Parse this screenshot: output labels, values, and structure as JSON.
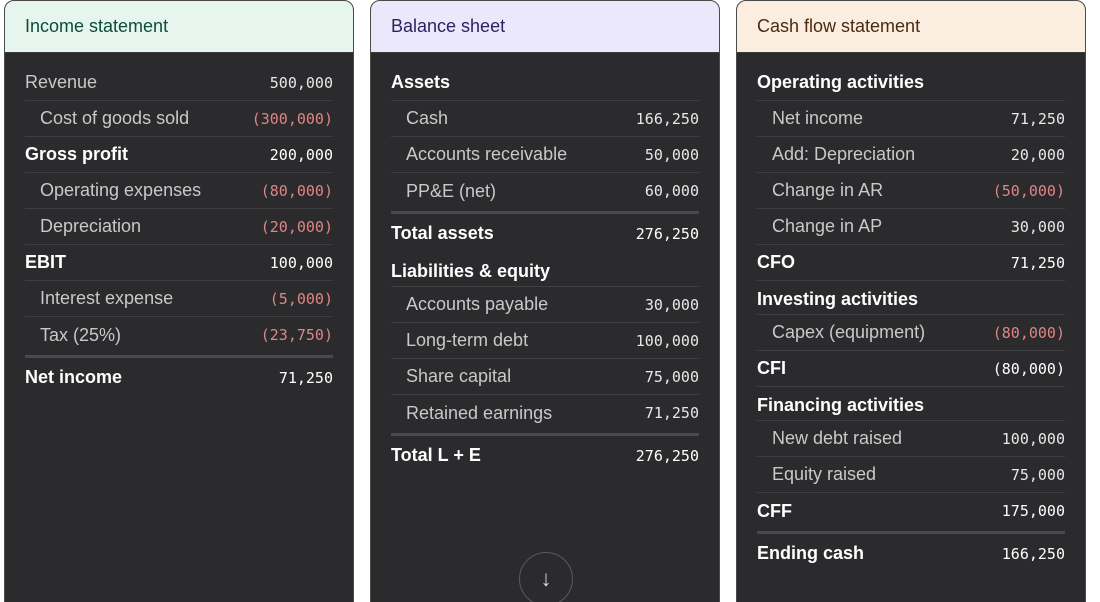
{
  "income": {
    "title": "Income statement",
    "rows": [
      {
        "label": "Revenue",
        "value": "500,000"
      },
      {
        "label": "Cost of goods sold",
        "value": "(300,000)"
      },
      {
        "label": "Gross profit",
        "value": "200,000"
      },
      {
        "label": "Operating expenses",
        "value": "(80,000)"
      },
      {
        "label": "Depreciation",
        "value": "(20,000)"
      },
      {
        "label": "EBIT",
        "value": "100,000"
      },
      {
        "label": "Interest expense",
        "value": "(5,000)"
      },
      {
        "label": "Tax (25%)",
        "value": "(23,750)"
      },
      {
        "label": "Net income",
        "value": "71,250"
      }
    ]
  },
  "balance": {
    "title": "Balance sheet",
    "assets_heading": "Assets",
    "assets": [
      {
        "label": "Cash",
        "value": "166,250"
      },
      {
        "label": "Accounts receivable",
        "value": "50,000"
      },
      {
        "label": "PP&E (net)",
        "value": "60,000"
      }
    ],
    "total_assets": {
      "label": "Total assets",
      "value": "276,250"
    },
    "liab_heading": "Liabilities & equity",
    "liabilities": [
      {
        "label": "Accounts payable",
        "value": "30,000"
      },
      {
        "label": "Long-term debt",
        "value": "100,000"
      },
      {
        "label": "Share capital",
        "value": "75,000"
      },
      {
        "label": "Retained earnings",
        "value": "71,250"
      }
    ],
    "total_le": {
      "label": "Total L + E",
      "value": "276,250"
    },
    "scroll_icon": "↓"
  },
  "cash": {
    "title": "Cash flow statement",
    "op_heading": "Operating activities",
    "op": [
      {
        "label": "Net income",
        "value": "71,250"
      },
      {
        "label": "Add: Depreciation",
        "value": "20,000"
      },
      {
        "label": "Change in AR",
        "value": "(50,000)"
      },
      {
        "label": "Change in AP",
        "value": "30,000"
      }
    ],
    "cfo": {
      "label": "CFO",
      "value": "71,250"
    },
    "inv_heading": "Investing activities",
    "inv": [
      {
        "label": "Capex (equipment)",
        "value": "(80,000)"
      }
    ],
    "cfi": {
      "label": "CFI",
      "value": "(80,000)"
    },
    "fin_heading": "Financing activities",
    "fin": [
      {
        "label": "New debt raised",
        "value": "100,000"
      },
      {
        "label": "Equity raised",
        "value": "75,000"
      }
    ],
    "cff": {
      "label": "CFF",
      "value": "175,000"
    },
    "ending": {
      "label": "Ending cash",
      "value": "166,250"
    }
  },
  "colors": {
    "negative": "#e08585",
    "positive": "#7ed07a",
    "card_bg": "#2b2a2c"
  }
}
